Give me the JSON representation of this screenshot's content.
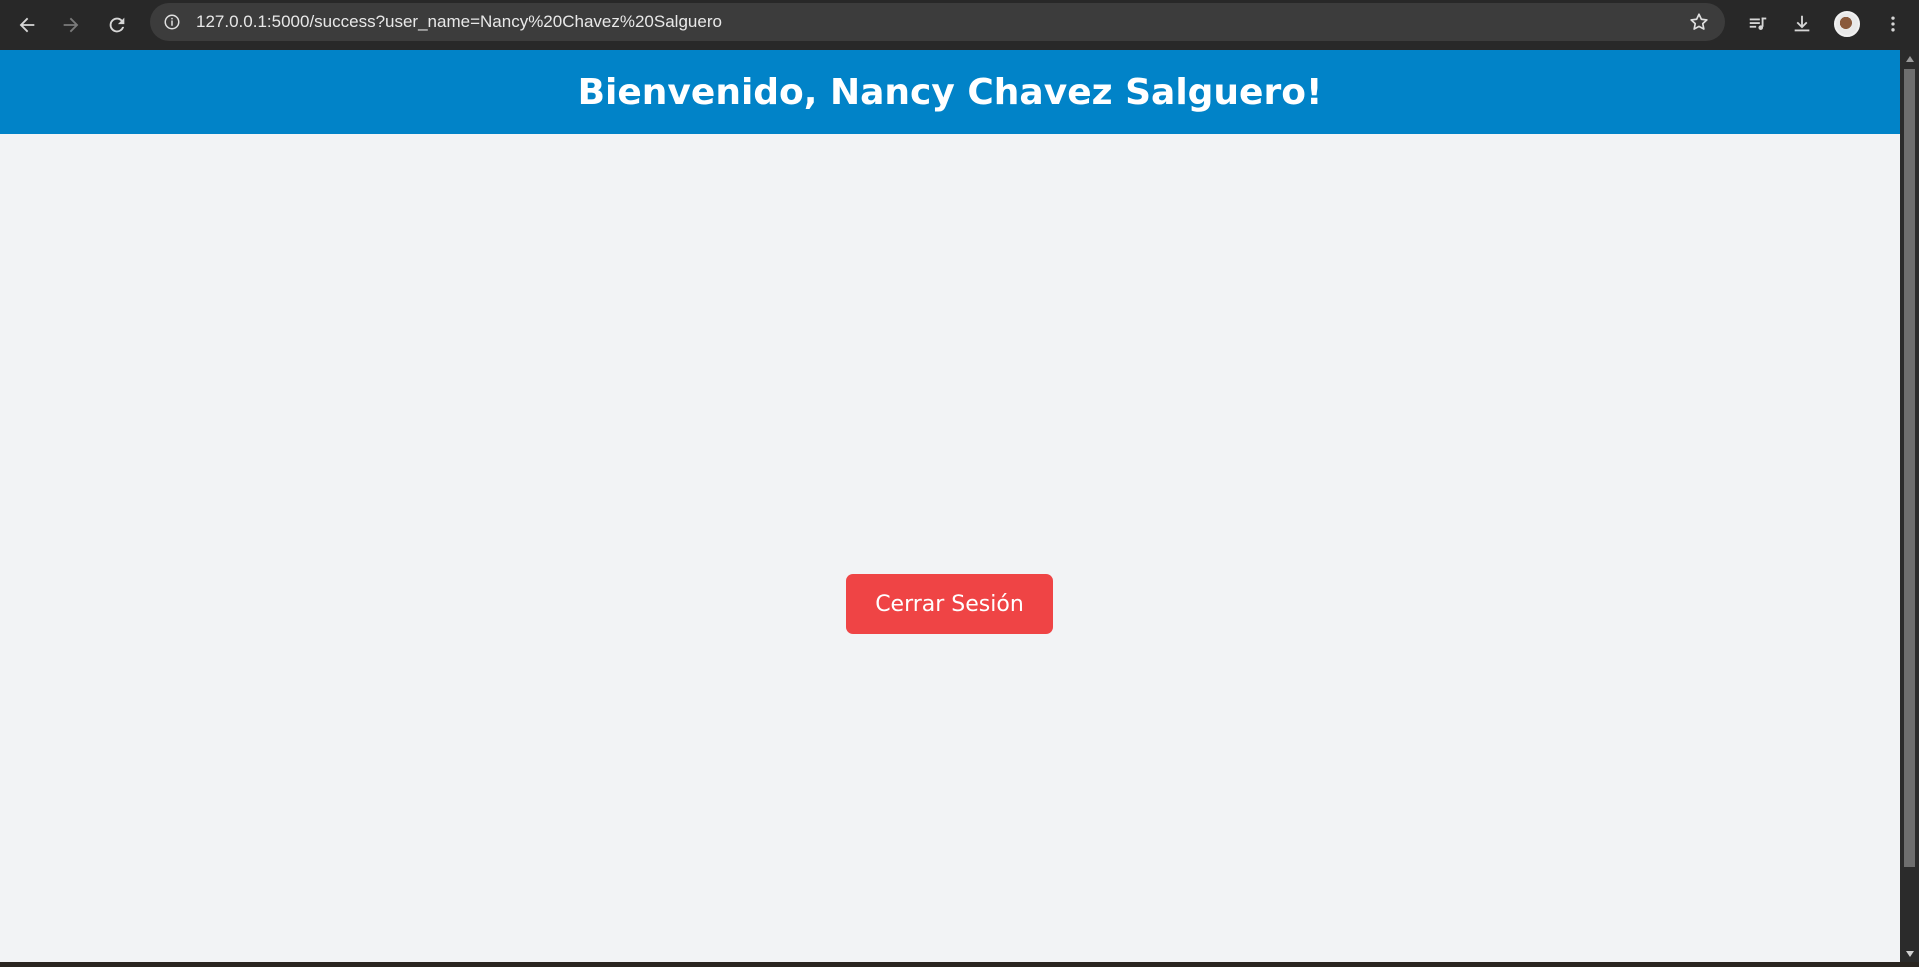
{
  "browser": {
    "url": "127.0.0.1:5000/success?user_name=Nancy%20Chavez%20Salguero",
    "icons": {
      "back": "back-arrow-icon",
      "forward": "forward-arrow-icon",
      "reload": "reload-icon",
      "site_info": "info-icon",
      "bookmark": "star-icon",
      "media": "media-playlist-icon",
      "download": "download-icon",
      "profile": "avatar",
      "menu": "kebab-menu-icon"
    }
  },
  "page": {
    "heading": "Bienvenido, Nancy Chavez Salguero!",
    "logout_label": "Cerrar Sesión"
  },
  "colors": {
    "banner": "#0183c8",
    "logout_button": "#ef4445",
    "page_background": "#f2f3f5",
    "chrome": "#282828"
  }
}
